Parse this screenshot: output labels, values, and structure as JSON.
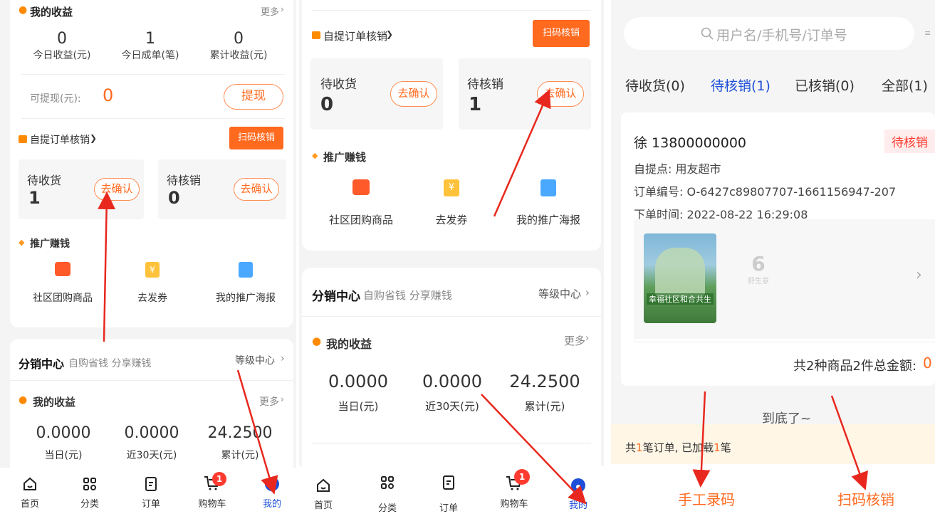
{
  "panel1": {
    "earnings_title": "我的收益",
    "more": "更多",
    "stats": [
      {
        "value": "0",
        "label": "今日收益(元)"
      },
      {
        "value": "1",
        "label": "今日成单(笔)"
      },
      {
        "value": "0",
        "label": "累计收益(元)"
      }
    ],
    "withdrawable_label": "可提现(元):",
    "withdrawable_value": "0",
    "withdraw_button": "提现",
    "pickup_title": "自提订单核销",
    "pickup_chevron": "❯",
    "scan_button": "扫码核销",
    "to_receive": {
      "label": "待收货",
      "count": "1",
      "button": "去确认"
    },
    "to_verify": {
      "label": "待核销",
      "count": "0",
      "button": "去确认"
    },
    "promo_title": "推广赚钱",
    "promo_items": [
      "社区团购商品",
      "去发券",
      "我的推广海报"
    ],
    "dist_title": "分销中心",
    "dist_sub": "自购省钱 分享赚钱",
    "level_link": "等级中心",
    "earnings2_title": "我的收益",
    "more2": "更多",
    "earn_stats": [
      {
        "value": "0.0000",
        "label": "当日(元)"
      },
      {
        "value": "0.0000",
        "label": "近30天(元)"
      },
      {
        "value": "24.2500",
        "label": "累计(元)"
      }
    ],
    "tabs": [
      "首页",
      "分类",
      "订单",
      "购物车",
      "我的"
    ],
    "cart_badge": "1"
  },
  "panel2": {
    "pickup_title": "自提订单核销",
    "pickup_chevron": "❯",
    "scan_button": "扫码核销",
    "to_receive": {
      "label": "待收货",
      "count": "0",
      "button": "去确认"
    },
    "to_verify": {
      "label": "待核销",
      "count": "1",
      "button": "去确认"
    },
    "promo_title": "推广赚钱",
    "promo_items": [
      "社区团购商品",
      "去发券",
      "我的推广海报"
    ],
    "dist_title": "分销中心",
    "dist_sub": "自购省钱 分享赚钱",
    "level_link": "等级中心",
    "earnings_title": "我的收益",
    "more": "更多",
    "earn_stats": [
      {
        "value": "0.0000",
        "label": "当日(元)"
      },
      {
        "value": "0.0000",
        "label": "近30天(元)"
      },
      {
        "value": "24.2500",
        "label": "累计(元)"
      }
    ],
    "tabs": [
      "首页",
      "分类",
      "订单",
      "购物车",
      "我的"
    ],
    "cart_badge": "1"
  },
  "panel3": {
    "search_placeholder": "用户名/手机号/订单号",
    "filter_tabs": [
      "待收货(0)",
      "待核销(1)",
      "已核销(0)",
      "全部(1)"
    ],
    "order": {
      "customer": "徐 13800000000",
      "status": "待核销",
      "pickup_point": "自提点: 用友超市",
      "order_no": "订单编号: O-6427c89807707-1661156947-207",
      "order_time": "下单时间: 2022-08-22 16:29:08",
      "image_caption": "幸福社区和合共生",
      "thumb_label": "舒生意",
      "summary": "共2种商品2件总金额:",
      "total": "0"
    },
    "end_text": "到底了~",
    "loaded_prefix": "共",
    "loaded_count1": "1",
    "loaded_mid": "笔订单, 已加载",
    "loaded_count2": "1",
    "loaded_suffix": "笔",
    "manual_button": "手工录码",
    "scan_button": "扫码核销"
  },
  "colors": {
    "accent": "#ff6a1f",
    "active_tab": "#1e4fd8",
    "arrow": "#e8281e"
  }
}
